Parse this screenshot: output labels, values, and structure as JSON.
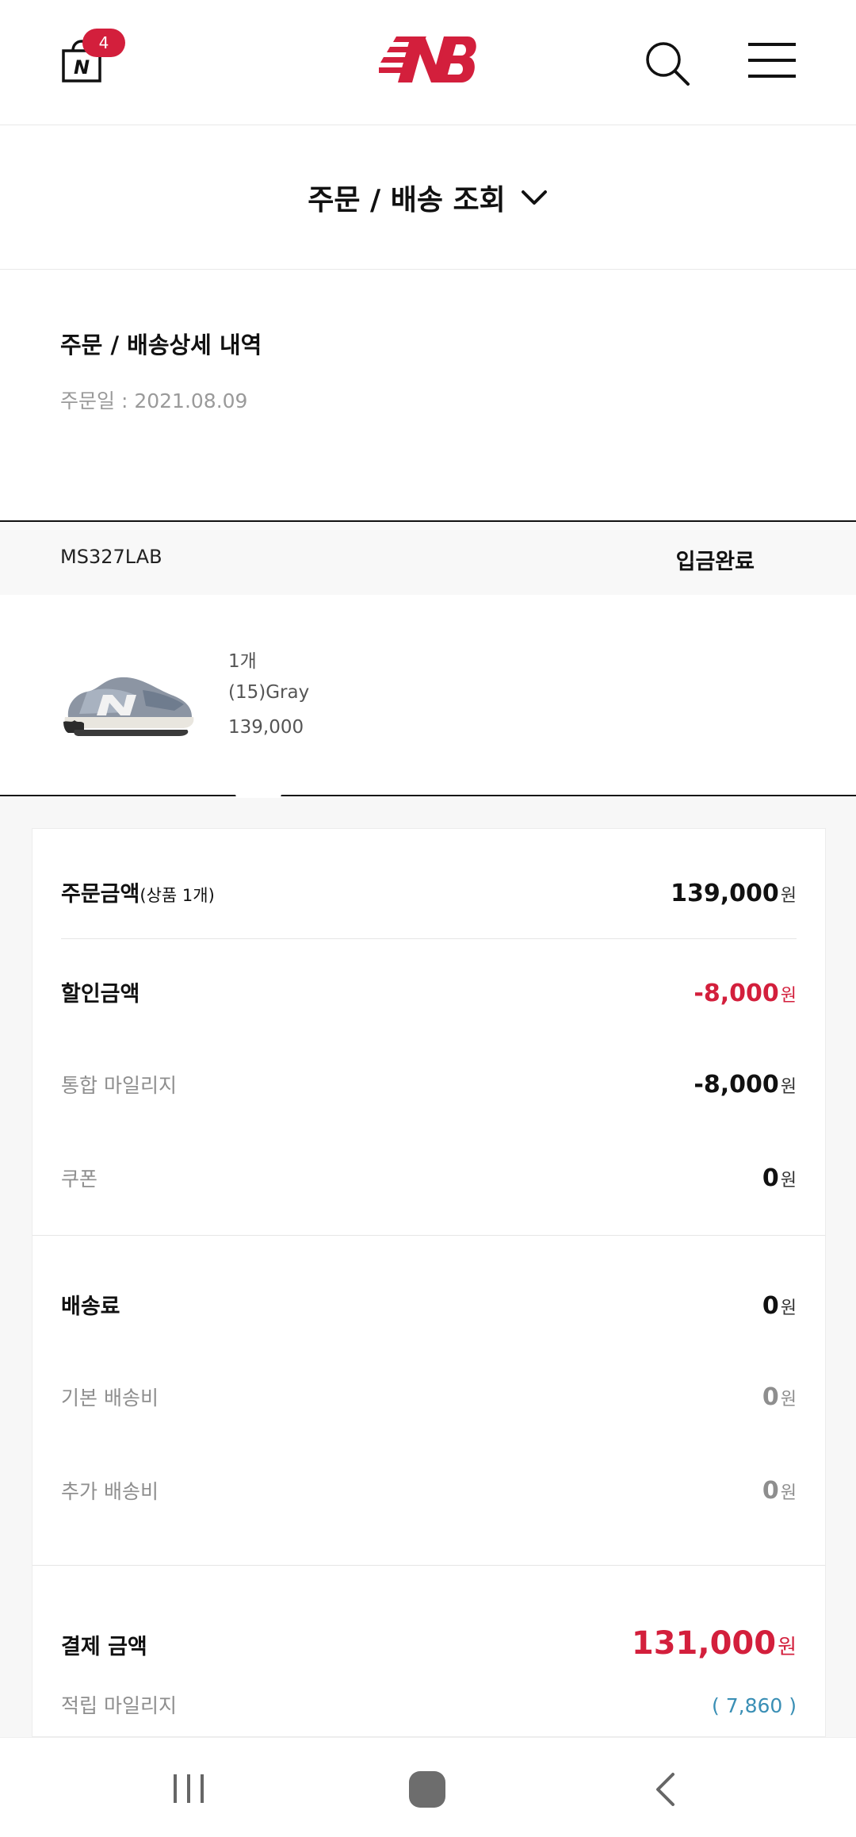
{
  "header": {
    "bag_icon": "shopping-bag-icon",
    "bag_letter": "N",
    "cart_count": "4",
    "logo_icon": "new-balance-logo",
    "search_icon": "search-icon",
    "menu_icon": "hamburger-menu-icon",
    "brand_color": "#d31f3c"
  },
  "page": {
    "title": "주문 / 배송 조회",
    "dropdown_icon": "chevron-down-icon"
  },
  "detail": {
    "title": "주문 / 배송상세 내역",
    "order_date": "주문일 : 2021.08.09"
  },
  "item": {
    "code": "MS327LAB",
    "status": "입금완료",
    "image": "gray-sneaker-image",
    "quantity": "1개",
    "option": "(15)Gray",
    "price": "139,000"
  },
  "summary": {
    "order_amount_label": "주문금액",
    "order_amount_sub": "(상품 1개)",
    "order_amount": "139,000",
    "discount_label": "할인금액",
    "discount": "-8,000",
    "mileage_label": "통합 마일리지",
    "mileage": "-8,000",
    "coupon_label": "쿠폰",
    "coupon": "0",
    "shipping_label": "배송료",
    "shipping": "0",
    "base_shipping_label": "기본 배송비",
    "base_shipping": "0",
    "extra_shipping_label": "추가 배송비",
    "extra_shipping": "0",
    "payment_label": "결제 금액",
    "payment": "131,000",
    "earned_mileage_label": "적립 마일리지",
    "earned_mileage": "( 7,860 )",
    "currency": "원"
  },
  "navbar": {
    "recent_icon": "recent-apps-icon",
    "home_icon": "home-icon",
    "back_icon": "back-icon"
  }
}
